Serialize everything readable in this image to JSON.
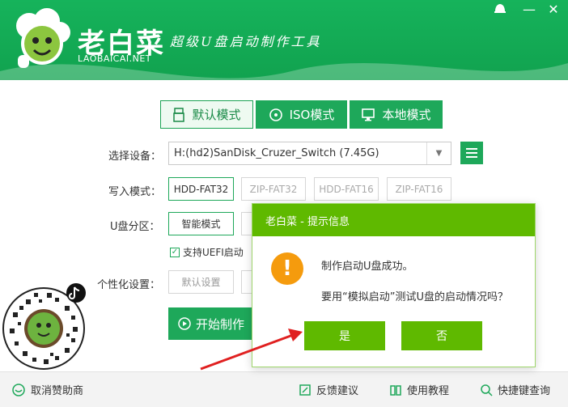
{
  "header": {
    "title": "老白菜",
    "domain": "LAOBAICAI.NET",
    "slogan": "超级U盘启动制作工具"
  },
  "window": {
    "minimize": "—",
    "close": "✕"
  },
  "tabs": [
    {
      "label": "默认模式",
      "icon": "usb-icon"
    },
    {
      "label": "ISO模式",
      "icon": "disc-icon"
    },
    {
      "label": "本地模式",
      "icon": "monitor-icon"
    }
  ],
  "form": {
    "device_label": "选择设备：",
    "device_value": "H:(hd2)SanDisk_Cruzer_Switch (7.45G)",
    "write_label": "写入模式：",
    "write_options": [
      "HDD-FAT32",
      "ZIP-FAT32",
      "HDD-FAT16",
      "ZIP-FAT16"
    ],
    "partition_label": "U盘分区：",
    "partition_value": "智能模式",
    "uefi_label": "支持UEFI启动",
    "personal_label": "个性化设置：",
    "personal_button": "默认设置",
    "start_button": "开始制作"
  },
  "footer": {
    "cancel_sponsor": "取消赞助商",
    "feedback": "反馈建议",
    "tutorial": "使用教程",
    "shortcut": "快捷键查询"
  },
  "dialog": {
    "title": "老白菜 - 提示信息",
    "message1": "制作启动U盘成功。",
    "message2": "要用“模拟启动”测试U盘的启动情况吗？",
    "yes": "是",
    "no": "否"
  },
  "colors": {
    "brand_green": "#16b35b",
    "dialog_green": "#5fb900",
    "warning_orange": "#f59b0d",
    "arrow_red": "#e02020"
  }
}
